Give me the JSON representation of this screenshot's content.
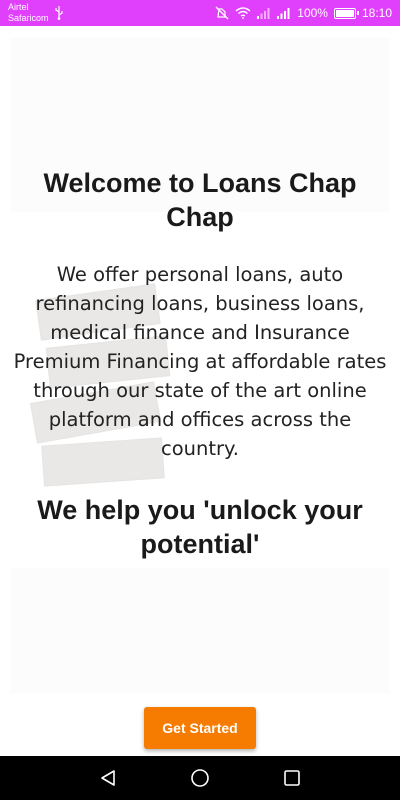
{
  "status_bar": {
    "carrier_1": "Airtel",
    "carrier_2": "Safaricom",
    "battery_percent": "100%",
    "battery_level": 1.0,
    "time": "18:10",
    "background_color": "#e040fb"
  },
  "main": {
    "welcome_title": "Welcome to Loans Chap Chap",
    "intro_text": "We offer personal loans, auto refinancing loans, business loans, medical finance and Insurance Premium Financing at affordable rates through our state of the art online platform and offices across the country.",
    "tagline": "We help you 'unlock your potential'"
  },
  "actions": {
    "get_started_label": "Get Started",
    "accent_color": "#f57c00"
  },
  "nav_bar": {
    "icons": [
      "back-icon",
      "home-icon",
      "recents-icon"
    ]
  }
}
